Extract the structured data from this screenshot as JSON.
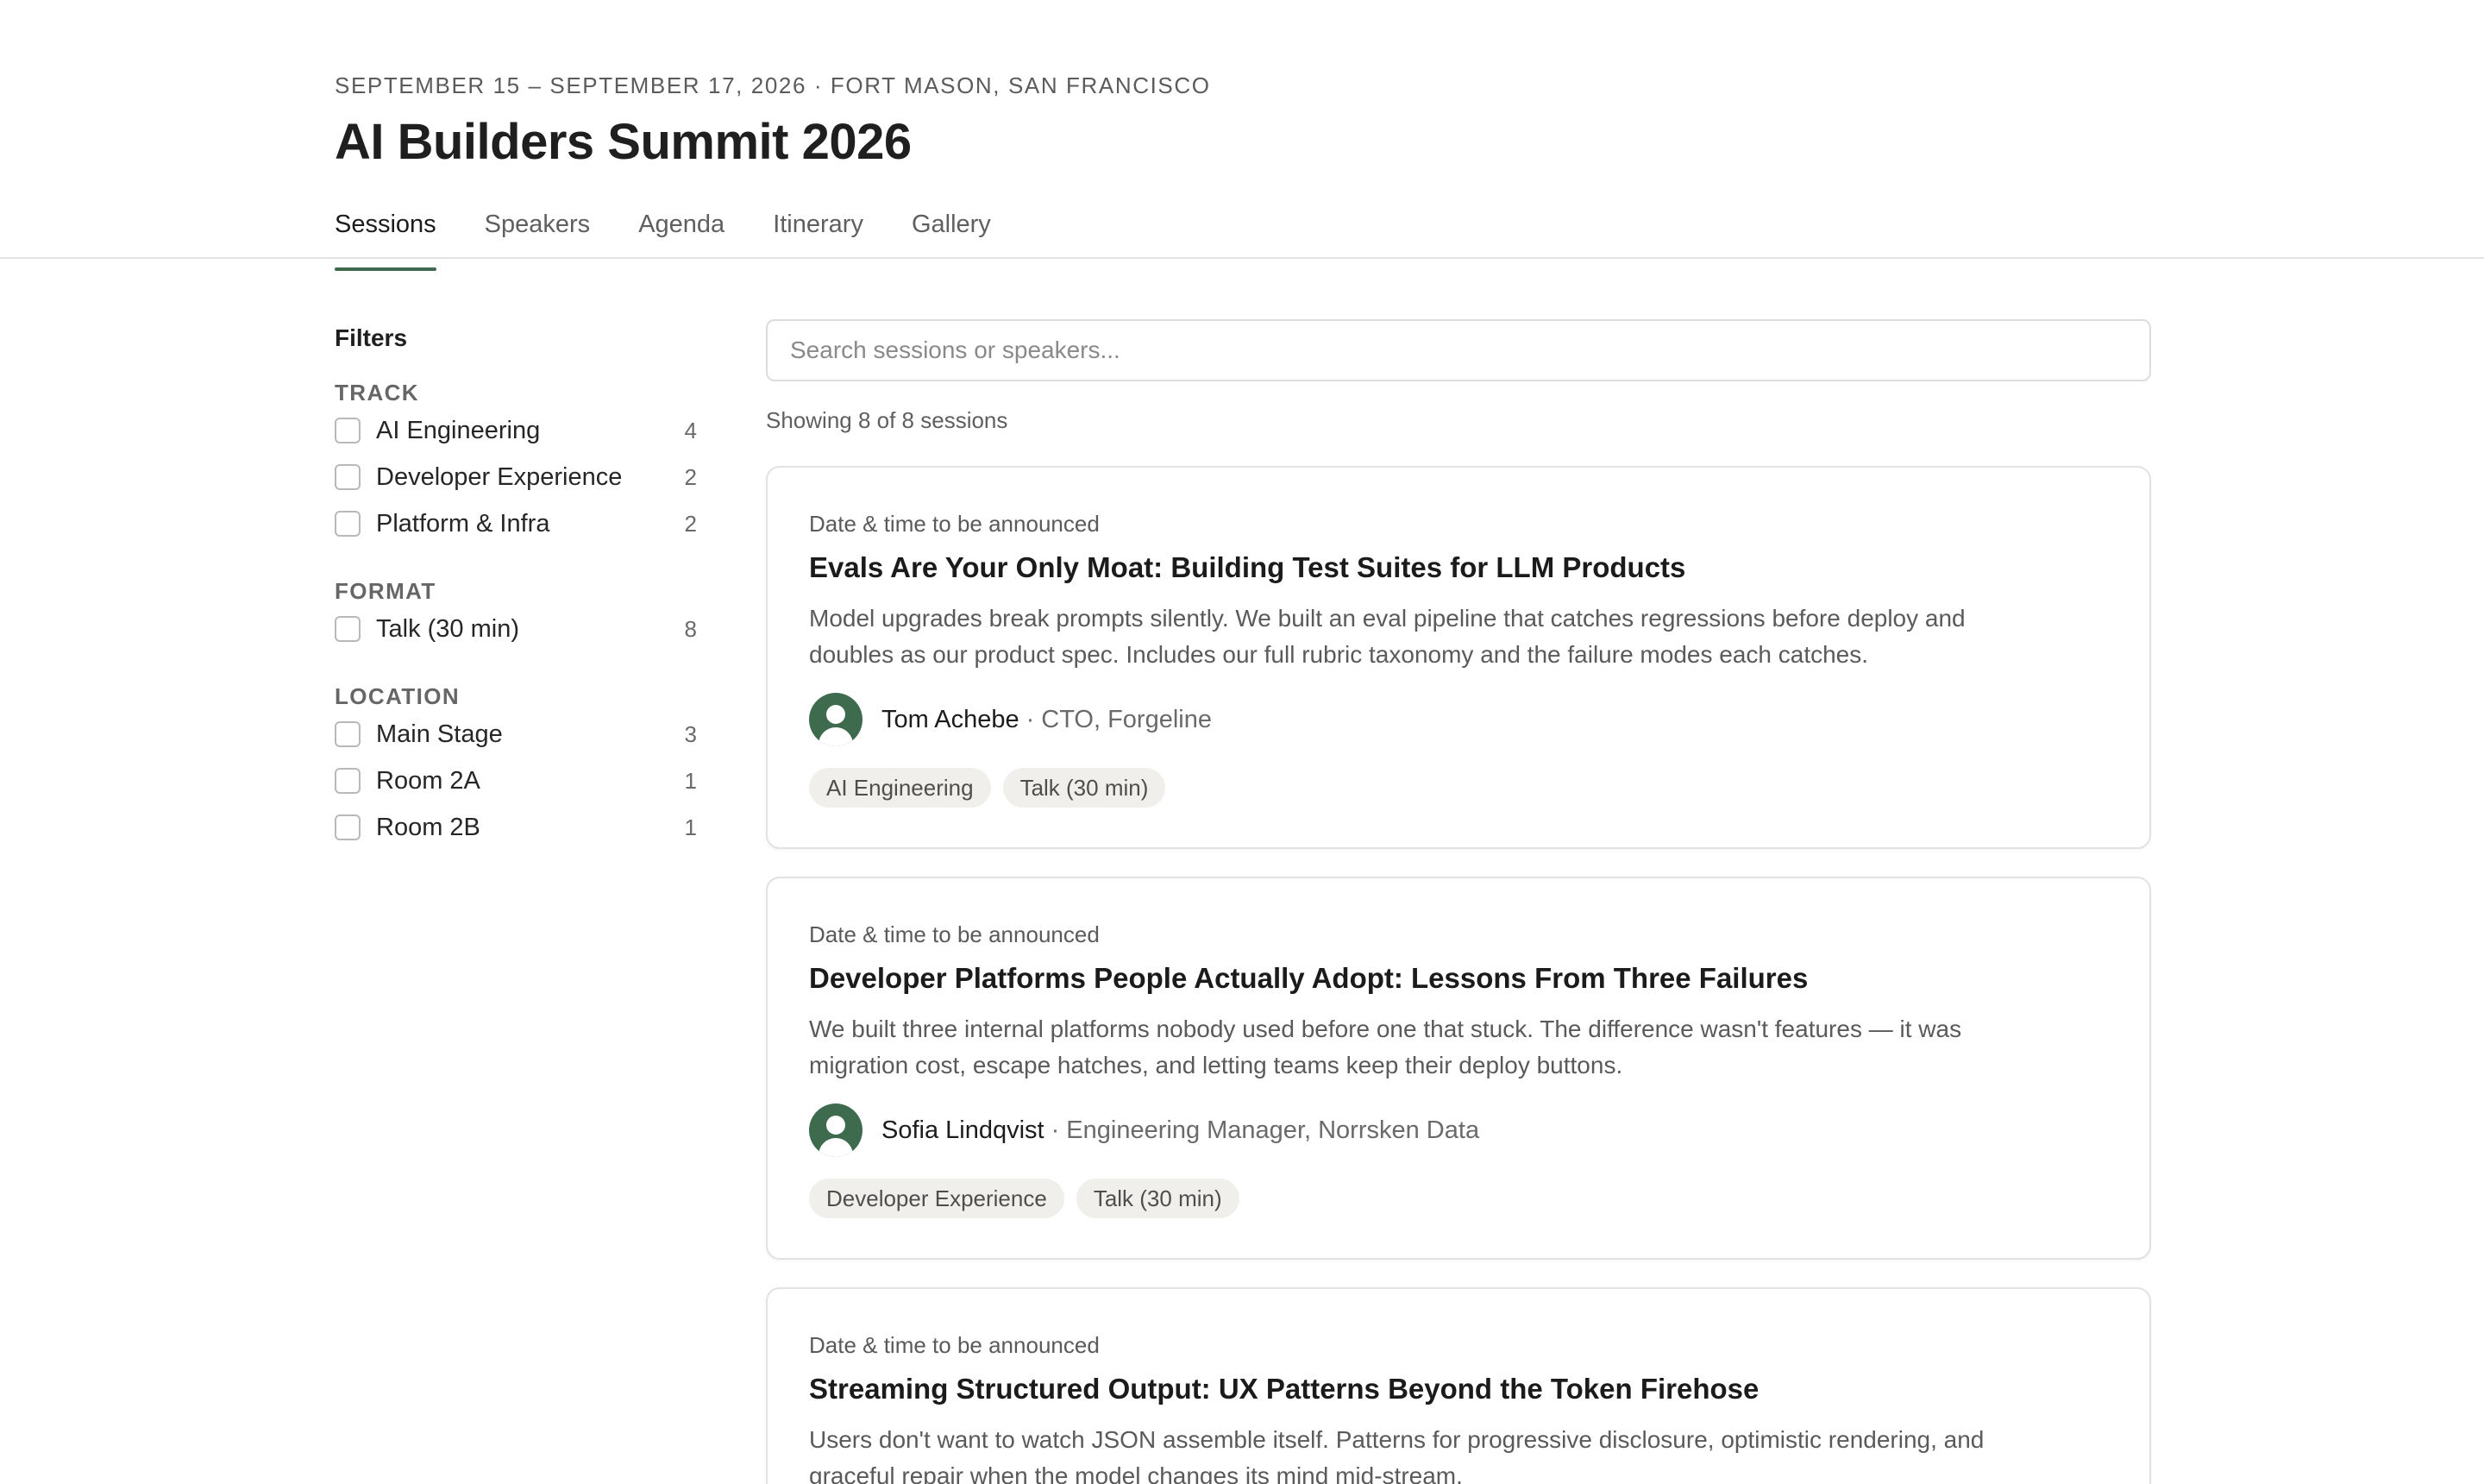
{
  "event": {
    "date_location": "SEPTEMBER 15 – SEPTEMBER 17, 2026 · FORT MASON, SAN FRANCISCO",
    "title": "AI Builders Summit 2026"
  },
  "tabs": [
    {
      "label": "Sessions",
      "active": true
    },
    {
      "label": "Speakers",
      "active": false
    },
    {
      "label": "Agenda",
      "active": false
    },
    {
      "label": "Itinerary",
      "active": false
    },
    {
      "label": "Gallery",
      "active": false
    }
  ],
  "filters": {
    "title": "Filters",
    "track": {
      "label": "TRACK",
      "options": [
        {
          "label": "AI Engineering",
          "count": "4"
        },
        {
          "label": "Developer Experience",
          "count": "2"
        },
        {
          "label": "Platform & Infra",
          "count": "2"
        }
      ]
    },
    "format": {
      "label": "FORMAT",
      "options": [
        {
          "label": "Talk (30 min)",
          "count": "8"
        }
      ]
    },
    "location": {
      "label": "LOCATION",
      "options": [
        {
          "label": "Main Stage",
          "count": "3"
        },
        {
          "label": "Room 2A",
          "count": "1"
        },
        {
          "label": "Room 2B",
          "count": "1"
        }
      ]
    }
  },
  "search": {
    "placeholder": "Search sessions or speakers...",
    "value": ""
  },
  "showing": "Showing 8 of 8 sessions",
  "sessions": [
    {
      "when": "Date & time to be announced",
      "title": "Evals Are Your Only Moat: Building Test Suites for LLM Products",
      "description": "Model upgrades break prompts silently. We built an eval pipeline that catches regressions before deploy and doubles as our product spec. Includes our full rubric taxonomy and the failure modes each catches.",
      "speaker": "Tom Achebe",
      "separator": "·",
      "role": "CTO, Forgeline",
      "tags": [
        "AI Engineering",
        "Talk (30 min)"
      ]
    },
    {
      "when": "Date & time to be announced",
      "title": "Developer Platforms People Actually Adopt: Lessons From Three Failures",
      "description": "We built three internal platforms nobody used before one that stuck. The difference wasn't features — it was migration cost, escape hatches, and letting teams keep their deploy buttons.",
      "speaker": "Sofia Lindqvist",
      "separator": "·",
      "role": "Engineering Manager, Norrsken Data",
      "tags": [
        "Developer Experience",
        "Talk (30 min)"
      ]
    },
    {
      "when": "Date & time to be announced",
      "title": "Streaming Structured Output: UX Patterns Beyond the Token Firehose",
      "description": "Users don't want to watch JSON assemble itself. Patterns for progressive disclosure, optimistic rendering, and graceful repair when the model changes its mind mid-stream."
    }
  ],
  "colors": {
    "accent": "#3f6b4f",
    "avatar": "#3e6b4e",
    "tag_bg": "#f0efeb"
  }
}
